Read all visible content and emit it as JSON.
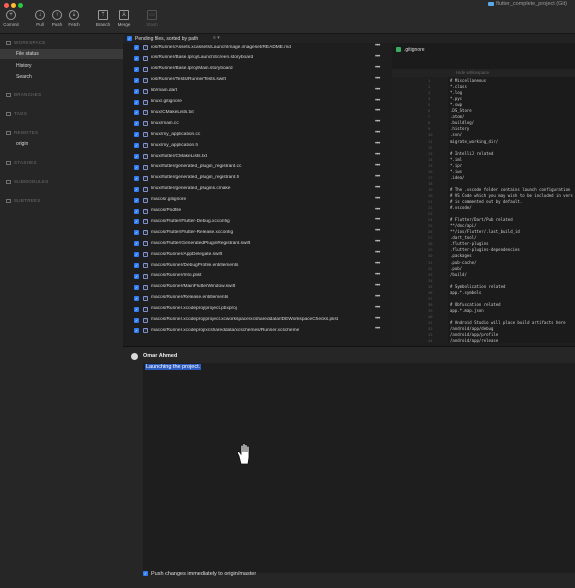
{
  "window": {
    "title": "flutter_complete_project (Git)"
  },
  "toolbar": {
    "buttons": [
      {
        "label": "Commit",
        "icon": "commit-icon"
      },
      {
        "label": "Pull",
        "icon": "pull-icon"
      },
      {
        "label": "Push",
        "icon": "push-icon"
      },
      {
        "label": "Fetch",
        "icon": "fetch-icon"
      },
      {
        "label": "Branch",
        "icon": "branch-icon"
      },
      {
        "label": "Merge",
        "icon": "merge-icon"
      },
      {
        "label": "Stash",
        "icon": "stash-icon"
      }
    ]
  },
  "sidebar": {
    "workspace": "WORKSPACE",
    "items": [
      "File status",
      "History",
      "Search"
    ],
    "branches": "BRANCHES",
    "tags": "TAGS",
    "remotes": "REMOTES",
    "remote_origin": "origin",
    "stashes": "STASHES",
    "submodules": "SUBMODULES",
    "subtrees": "SUBTREES"
  },
  "pending": {
    "label": "Pending files, sorted by path",
    "options": "≡ ▾"
  },
  "files": [
    "ios/Runner/Assets.xcassets/LaunchImage.imageset/README.md",
    "ios/Runner/Base.lproj/LaunchScreen.storyboard",
    "ios/Runner/Base.lproj/Main.storyboard",
    "ios/Runner/Tests/RunnerTests.swift",
    "lib/main.dart",
    "linux/.gitignore",
    "linux/CMakeLists.txt",
    "linux/main.cc",
    "linux/my_application.cc",
    "linux/my_application.h",
    "linux/flutter/CMakeLists.txt",
    "linux/flutter/generated_plugin_registrant.cc",
    "linux/flutter/generated_plugin_registrant.h",
    "linux/flutter/generated_plugins.cmake",
    "macos/.gitignore",
    "macos/Podfile",
    "macos/Flutter/Flutter-Debug.xcconfig",
    "macos/Flutter/Flutter-Release.xcconfig",
    "macos/Flutter/GeneratedPluginRegistrant.swift",
    "macos/Runner/AppDelegate.swift",
    "macos/Runner/DebugProfile.entitlements",
    "macos/Runner/Info.plist",
    "macos/Runner/MainFlutterWindow.swift",
    "macos/Runner/Release.entitlements",
    "macos/Runner.xcodeproj/project.pbxproj",
    "macos/Runner.xcodeproj/project.xcworkspace/xcshareddata/IDEWorkspaceChecks.plist",
    "macos/Runner.xcodeproj/xcshareddata/xcschemes/Runner.xcscheme"
  ],
  "more_glyph": "•••",
  "diff": {
    "filename": ".gitignore",
    "hunk": "Hide whitespace",
    "lines": [
      "# Miscellaneous",
      "*.class",
      "*.log",
      "*.pyc",
      "*.swp",
      ".DS_Store",
      ".atom/",
      ".buildlog/",
      ".history",
      ".svn/",
      "migrate_working_dir/",
      "",
      "# IntelliJ related",
      "*.iml",
      "*.ipr",
      "*.iws",
      ".idea/",
      "",
      "# The .vscode folder contains launch configuration",
      "# VS Code which you may wish to be included in vers",
      "# is commented out by default.",
      "#.vscode/",
      "",
      "# Flutter/Dart/Pub related",
      "**/doc/api/",
      "**/ios/Flutter/.last_build_id",
      ".dart_tool/",
      ".flutter-plugins",
      ".flutter-plugins-dependencies",
      ".packages",
      ".pub-cache/",
      ".pub/",
      "/build/",
      "",
      "# Symbolication related",
      "app.*.symbols",
      "",
      "# Obfuscation related",
      "app.*.map.json",
      "",
      "# Android Studio will place build artifacts here",
      "/android/app/debug",
      "/android/app/profile",
      "/android/app/release"
    ]
  },
  "commit": {
    "author": "Omar Ahmed",
    "message": "Launching the project.",
    "push_option": "Push changes immediately to origin/master"
  },
  "colors": {
    "accent": "#2f7df6",
    "selection": "#2c5cc0",
    "added_icon": "#3cab63"
  }
}
